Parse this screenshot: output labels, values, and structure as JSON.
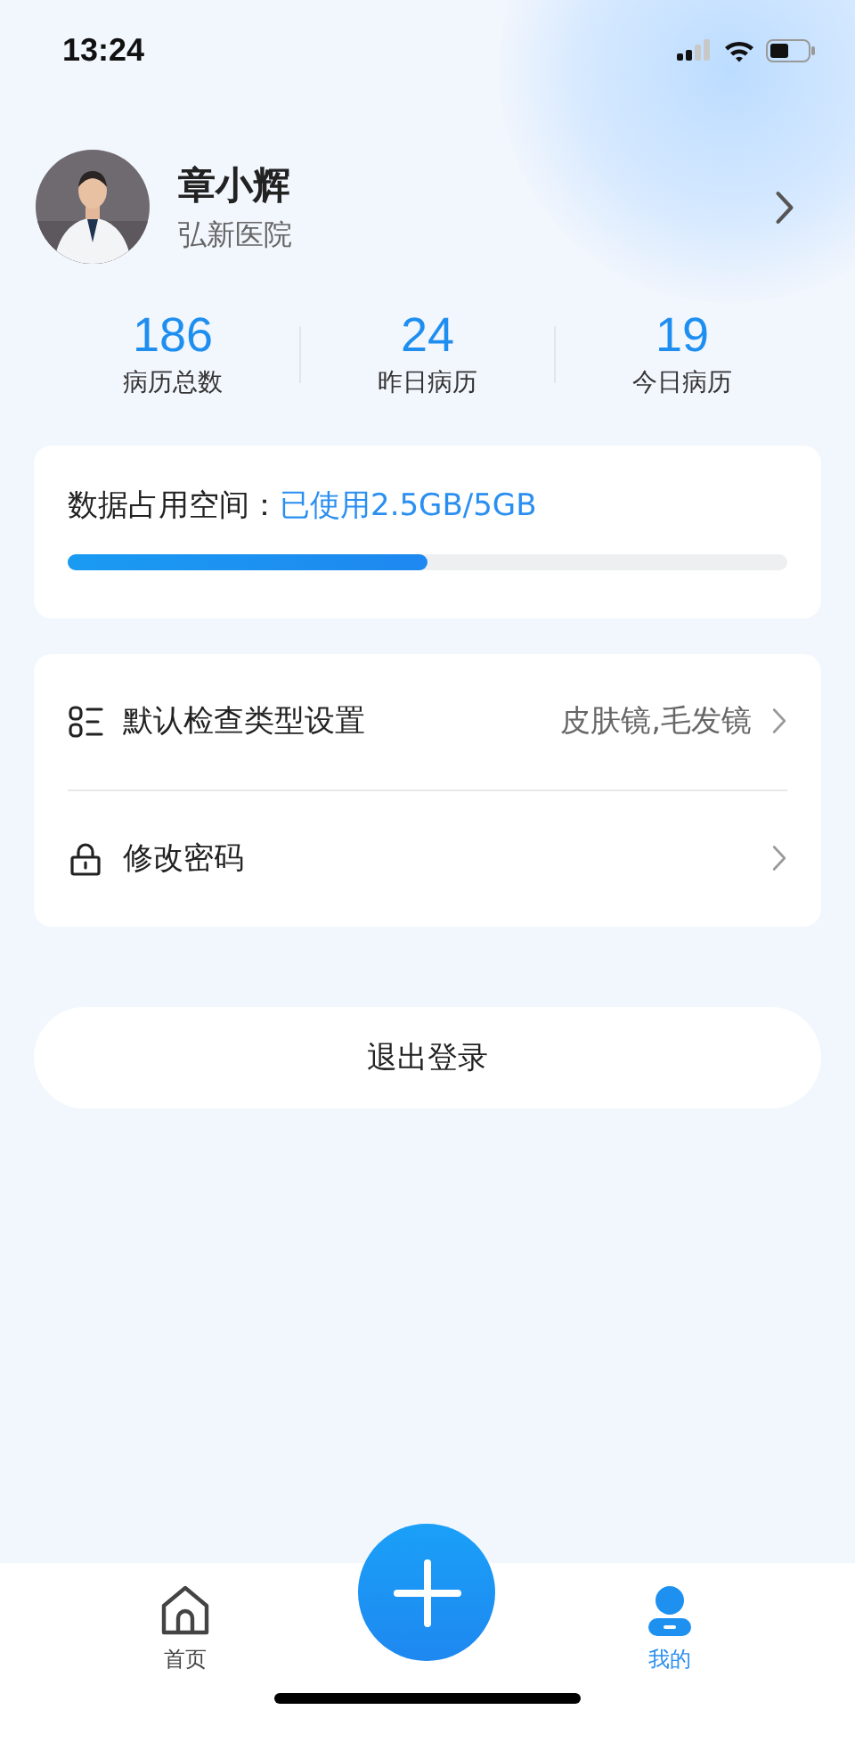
{
  "status_bar": {
    "time": "13:24"
  },
  "profile": {
    "name": "章小辉",
    "hospital": "弘新医院"
  },
  "stats": [
    {
      "value": "186",
      "label": "病历总数"
    },
    {
      "value": "24",
      "label": "昨日病历"
    },
    {
      "value": "19",
      "label": "今日病历"
    }
  ],
  "storage": {
    "label": "数据占用空间：",
    "usage": "已使用2.5GB/5GB",
    "level": 0.5
  },
  "settings": [
    {
      "kind": "list",
      "label": "默认检查类型设置",
      "value": "皮肤镜,毛发镜"
    },
    {
      "kind": "lock",
      "label": "修改密码"
    }
  ],
  "logout": "退出登录",
  "tab_bar": [
    {
      "kind": "home",
      "label": "首页",
      "selected": false
    },
    {
      "kind": "add"
    },
    {
      "kind": "profile",
      "label": "我的",
      "selected": true
    }
  ]
}
